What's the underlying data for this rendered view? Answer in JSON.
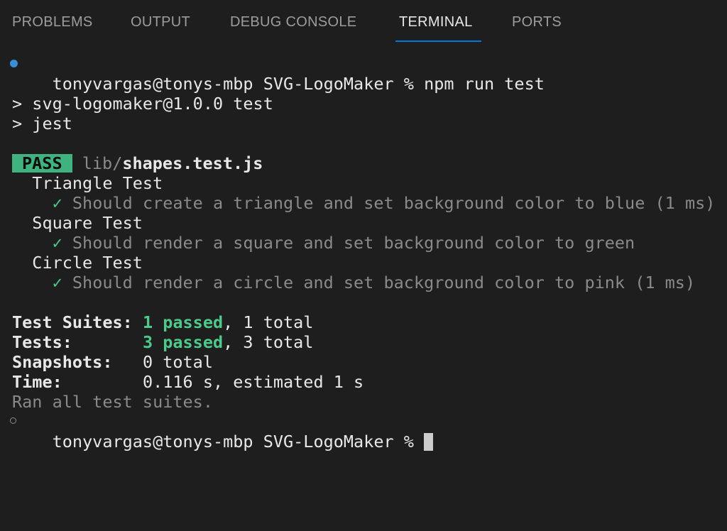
{
  "panel_tabs": [
    {
      "label": "PROBLEMS"
    },
    {
      "label": "OUTPUT"
    },
    {
      "label": "DEBUG CONSOLE"
    },
    {
      "label": "TERMINAL",
      "active": true
    },
    {
      "label": "PORTS"
    }
  ],
  "terminal": {
    "prompt": "tonyvargas@tonys-mbp SVG-LogoMaker %",
    "command": "npm run test",
    "script_line_1": "> svg-logomaker@1.0.0 test",
    "script_line_2": "> jest",
    "pass_badge": "PASS",
    "file_dir": "lib/",
    "file_name": "shapes.test.js",
    "groups": [
      {
        "name": "Triangle Test",
        "check": "✓",
        "test": "Should create a triangle and set background color to blue (1 ms)"
      },
      {
        "name": "Square Test",
        "check": "✓",
        "test": "Should render a square and set background color to green"
      },
      {
        "name": "Circle Test",
        "check": "✓",
        "test": "Should render a circle and set background color to pink (1 ms)"
      }
    ],
    "summary": {
      "suites_label": "Test Suites:",
      "suites_passed": "1 passed",
      "suites_total": ", 1 total",
      "tests_label": "Tests:",
      "tests_passed": "3 passed",
      "tests_total": ", 3 total",
      "snapshots_label": "Snapshots:",
      "snapshots_value": "0 total",
      "time_label": "Time:",
      "time_value": "0.116 s, estimated 1 s",
      "ran_all": "Ran all test suites."
    },
    "final_prompt": "tonyvargas@tonys-mbp SVG-LogoMaker %"
  },
  "colors": {
    "background": "#1e1e1e",
    "pass_green": "#4ec98b",
    "tab_underline": "#0078d4"
  }
}
